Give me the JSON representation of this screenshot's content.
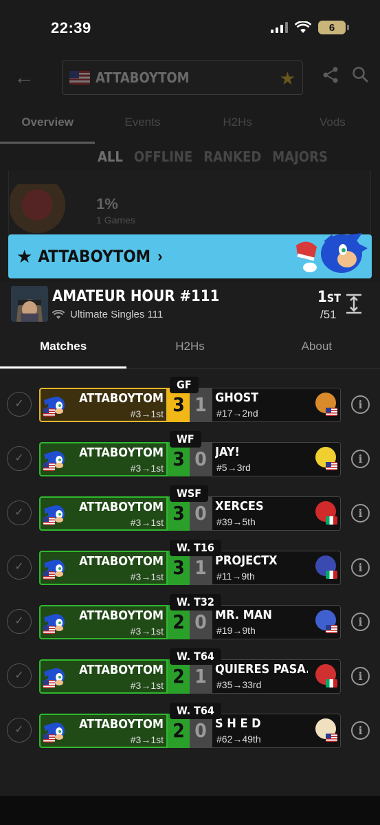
{
  "status_bar": {
    "time": "22:39",
    "battery": "6"
  },
  "header": {
    "player_name": "ATTABOYTOM"
  },
  "profile_tabs": [
    "Overview",
    "Events",
    "H2Hs",
    "Vods"
  ],
  "filters": [
    "ALL",
    "OFFLINE",
    "RANKED",
    "MAJORS"
  ],
  "background_stat": {
    "percent": "1%",
    "games": "1 Games"
  },
  "banner": {
    "name": "ATTABOYTOM",
    "chevron": "›"
  },
  "event": {
    "title": "AMATEUR HOUR #111",
    "subtitle": "Ultimate Singles 111",
    "placement": "1",
    "placement_suffix": "ST",
    "entrants": "/51"
  },
  "event_tabs": [
    "Matches",
    "H2Hs",
    "About"
  ],
  "matches": [
    {
      "round": "GF",
      "player": "ATTABOYTOM",
      "player_seed": "#3→1st",
      "player_score": "3",
      "opponent": "GHOST",
      "opponent_seed": "#17→2nd",
      "opponent_score": "1",
      "style": "gold",
      "opp_color": "#d98a2a",
      "opp_flag": "us"
    },
    {
      "round": "WF",
      "player": "ATTABOYTOM",
      "player_seed": "#3→1st",
      "player_score": "3",
      "opponent": "JAY!",
      "opponent_seed": "#5→3rd",
      "opponent_score": "0",
      "style": "green",
      "opp_color": "#f0d030",
      "opp_flag": "us"
    },
    {
      "round": "WSF",
      "player": "ATTABOYTOM",
      "player_seed": "#3→1st",
      "player_score": "3",
      "opponent": "XERCES",
      "opponent_seed": "#39→5th",
      "opponent_score": "0",
      "style": "green",
      "opp_color": "#d02a2a",
      "opp_flag": "mx"
    },
    {
      "round": "W. T16",
      "player": "ATTABOYTOM",
      "player_seed": "#3→1st",
      "player_score": "3",
      "opponent": "PROJECTX",
      "opponent_seed": "#11→9th",
      "opponent_score": "1",
      "style": "green",
      "opp_color": "#3a4ab0",
      "opp_flag": "mx"
    },
    {
      "round": "W. T32",
      "player": "ATTABOYTOM",
      "player_seed": "#3→1st",
      "player_score": "2",
      "opponent": "MR. MAN",
      "opponent_seed": "#19→9th",
      "opponent_score": "0",
      "style": "green",
      "opp_color": "#4060d0",
      "opp_flag": "us"
    },
    {
      "round": "W. T64",
      "player": "ATTABOYTOM",
      "player_seed": "#3→1st",
      "player_score": "2",
      "opponent": "QUIERES PASA...",
      "opponent_seed": "#35→33rd",
      "opponent_score": "1",
      "style": "green",
      "opp_color": "#d03030",
      "opp_flag": "mx"
    },
    {
      "round": "W. T64",
      "player": "ATTABOYTOM",
      "player_seed": "#3→1st",
      "player_score": "2",
      "opponent": "S H E D",
      "opponent_seed": "#62→49th",
      "opponent_score": "0",
      "style": "green",
      "opp_color": "#f0e0c0",
      "opp_flag": "us"
    }
  ],
  "colors": {
    "banner": "#56c4ea",
    "win_green": "#2aa02a",
    "gold": "#f1b716",
    "sonic_blue": "#1f4fd0"
  }
}
